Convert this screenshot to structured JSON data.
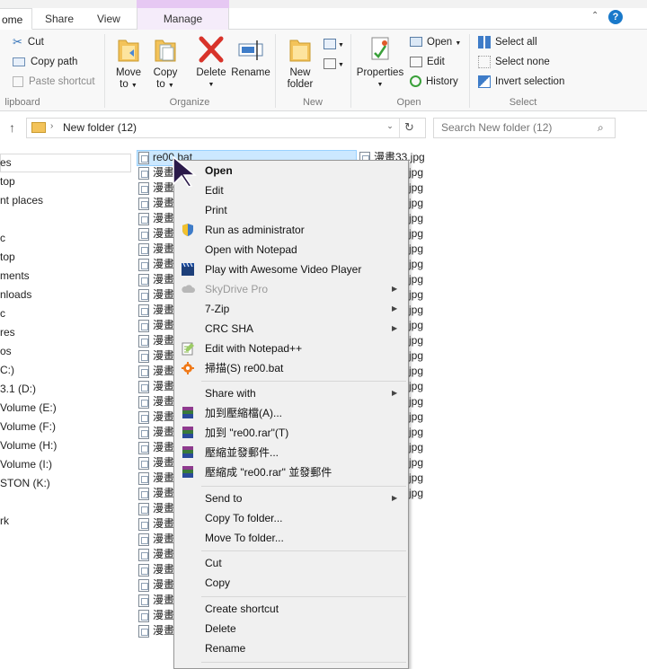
{
  "ribbon_tabs": {
    "home": "ome",
    "share": "Share",
    "view": "View",
    "manage": "Manage"
  },
  "clipboard": {
    "cut": "Cut",
    "copy_path": "Copy path",
    "paste_shortcut": "Paste shortcut",
    "group": "lipboard"
  },
  "organize": {
    "move_to": "Move",
    "move_to2": "to",
    "copy_to": "Copy",
    "copy_to2": "to",
    "delete": "Delete",
    "rename": "Rename",
    "group": "Organize"
  },
  "new_group": {
    "new_folder": "New",
    "new_folder2": "folder",
    "group": "New"
  },
  "open_group": {
    "properties": "Properties",
    "open": "Open",
    "edit": "Edit",
    "history": "History",
    "group": "Open"
  },
  "select_group": {
    "select_all": "Select all",
    "select_none": "Select none",
    "invert": "Invert selection",
    "group": "Select"
  },
  "address": {
    "path": "New folder (12)",
    "search_placeholder": "Search New folder (12)"
  },
  "nav": [
    {
      "label": "es"
    },
    {
      "label": "top"
    },
    {
      "label": "nt places"
    },
    {
      "label": ""
    },
    {
      "label": "c"
    },
    {
      "label": "top"
    },
    {
      "label": "ments"
    },
    {
      "label": "nloads"
    },
    {
      "label": "c"
    },
    {
      "label": "res"
    },
    {
      "label": "os"
    },
    {
      "label": "C:)"
    },
    {
      "label": "3.1 (D:)"
    },
    {
      "label": "Volume (E:)"
    },
    {
      "label": "Volume (F:)"
    },
    {
      "label": "Volume (H:)"
    },
    {
      "label": "Volume (I:)"
    },
    {
      "label": "STON (K:)"
    },
    {
      "label": ""
    },
    {
      "label": "rk"
    }
  ],
  "files": {
    "selected": "re00.bat",
    "partial": "漫畫",
    "right_first": "漫畫33.jpg",
    "right_ext": "jpg"
  },
  "context_menu": {
    "open": "Open",
    "edit": "Edit",
    "print": "Print",
    "run_admin": "Run as administrator",
    "open_notepad": "Open with Notepad",
    "play_awesome": "Play with Awesome Video Player",
    "skydrive": "SkyDrive Pro",
    "sevenzip": "7-Zip",
    "crcsha": "CRC SHA",
    "edit_notepadpp": "Edit with Notepad++",
    "scan": "掃描(S) re00.bat",
    "share_with": "Share with",
    "add_archive": "加到壓縮檔(A)...",
    "add_rar": "加到 \"re00.rar\"(T)",
    "compress_email": "壓縮並發郵件...",
    "compress_rar_email": "壓縮成 \"re00.rar\" 並發郵件",
    "send_to": "Send to",
    "copy_to_folder": "Copy To folder...",
    "move_to_folder": "Move To folder...",
    "cut": "Cut",
    "copy": "Copy",
    "create_shortcut": "Create shortcut",
    "delete": "Delete",
    "rename": "Rename"
  },
  "colors": {
    "accent": "#1979ca",
    "selection": "#cce8ff",
    "manage_tab": "#e6c8f3"
  }
}
